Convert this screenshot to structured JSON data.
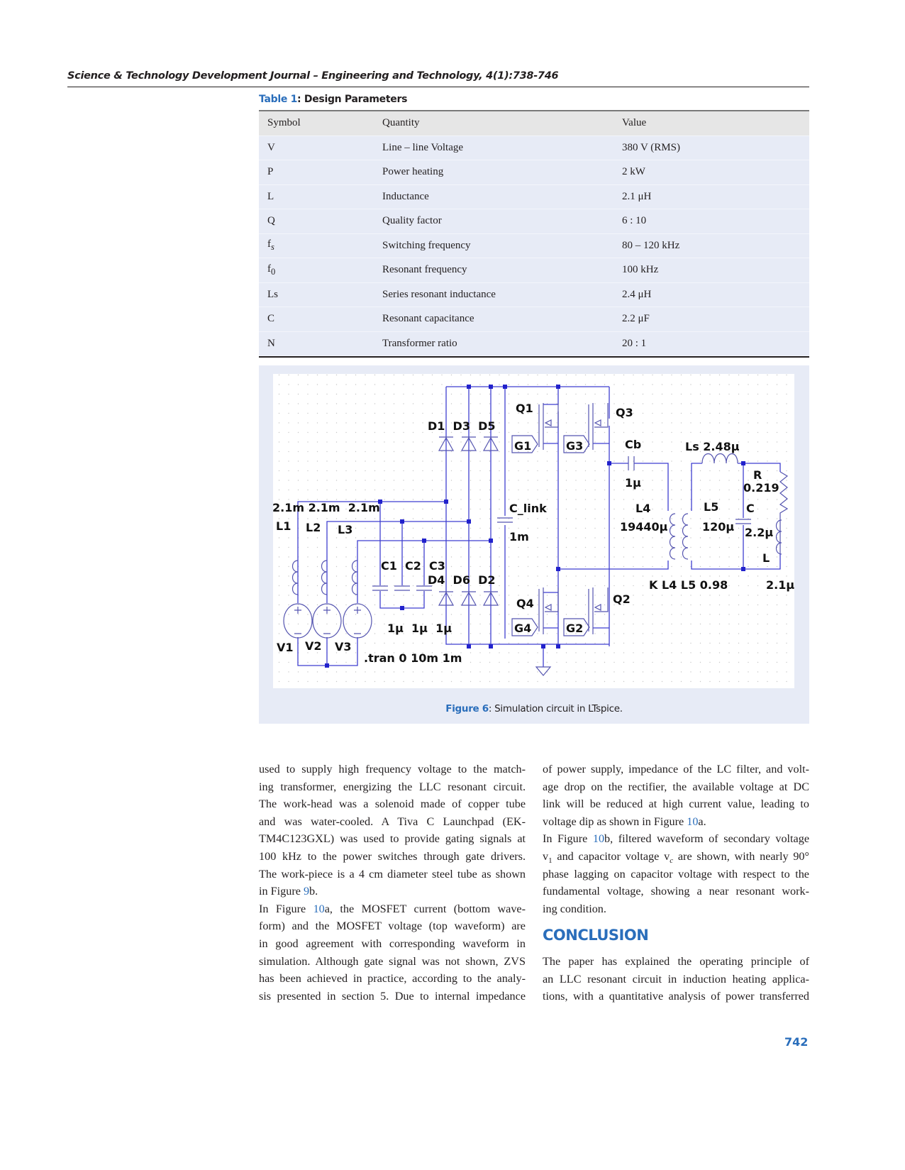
{
  "header": {
    "journal": "Science & Technology Development Journal – Engineering and Technology, 4(1):738-746"
  },
  "table": {
    "caption_label": "Table 1",
    "caption_text": ": Design Parameters",
    "columns": [
      "Symbol",
      "Quantity",
      "Value"
    ],
    "rows": [
      {
        "symbol": "V",
        "sub": "",
        "quantity": "Line – line Voltage",
        "value": "380 V (RMS)"
      },
      {
        "symbol": "P",
        "sub": "",
        "quantity": "Power heating",
        "value": "2 kW"
      },
      {
        "symbol": "L",
        "sub": "",
        "quantity": "Inductance",
        "value": "2.1 μH"
      },
      {
        "symbol": "Q",
        "sub": "",
        "quantity": "Quality factor",
        "value": "6 : 10"
      },
      {
        "symbol": "f",
        "sub": "s",
        "quantity": "Switching frequency",
        "value": "80 – 120 kHz"
      },
      {
        "symbol": "f",
        "sub": "0",
        "quantity": "Resonant frequency",
        "value": "100 kHz"
      },
      {
        "symbol": "Ls",
        "sub": "",
        "quantity": "Series resonant inductance",
        "value": "2.4 μH"
      },
      {
        "symbol": "C",
        "sub": "",
        "quantity": "Resonant capacitance",
        "value": "2.2 μF"
      },
      {
        "symbol": "N",
        "sub": "",
        "quantity": "Transformer ratio",
        "value": "20 : 1"
      }
    ]
  },
  "figure": {
    "caption_label": "Figure 6",
    "caption_text": ": Simulation circuit in LTspice.",
    "wire_color": "#3f3fd0",
    "labels": {
      "q1": "Q1",
      "q2": "Q2",
      "q3": "Q3",
      "q4": "Q4",
      "g1": "G1",
      "g2": "G2",
      "g3": "G3",
      "g4": "G4",
      "d_top": "D1  D3  D5",
      "d_bot": "D4  D6  D2",
      "c_link": "C_link",
      "c_link_val": "1m",
      "cb": "Cb",
      "cb_val": "1μ",
      "ls": "Ls 2.48μ",
      "r": "R",
      "r_val": "0.219",
      "c": "C",
      "c_val": "2.2μ",
      "l": "L",
      "l_val": "2.1μ",
      "l4": "L4",
      "l4_val": "19440μ",
      "l5": "L5",
      "l5_val": "120μ",
      "k": "K L4 L5 0.98",
      "l_vals": "2.1m 2.1m  2.1m",
      "l1": "L1",
      "l2": "L2",
      "l3": "L3",
      "c123": "C1  C2  C3",
      "c123_val": "1μ  1μ  1μ",
      "v1": "V1",
      "v2": "V2",
      "v3": "V3",
      "tran": ".tran 0 10m 1m"
    }
  },
  "body": {
    "left_column": [
      [
        {
          "t": "used to supply high frequency voltage to the match-"
        }
      ],
      [
        {
          "t": "ing transformer, energizing the LLC resonant circuit."
        }
      ],
      [
        {
          "t": "The work-head was a solenoid made of copper tube"
        }
      ],
      [
        {
          "t": "and was water-cooled.   A Tiva C Launchpad (EK-"
        }
      ],
      [
        {
          "t": "TM4C123GXL) was used to provide gating signals at"
        }
      ],
      [
        {
          "t": "100 kHz to the power switches through gate drivers."
        }
      ],
      [
        {
          "t": "The work-piece is a 4 cm diameter steel tube as shown"
        }
      ],
      [
        {
          "t": "in Figure "
        },
        {
          "t": "9",
          "link": true
        },
        {
          "t": "b."
        }
      ],
      [
        {
          "t": "In Figure "
        },
        {
          "t": "10",
          "link": true
        },
        {
          "t": "a, the MOSFET current (bottom wave-"
        }
      ],
      [
        {
          "t": "form) and the MOSFET voltage (top waveform) are"
        }
      ],
      [
        {
          "t": "in good agreement with corresponding waveform in"
        }
      ],
      [
        {
          "t": "simulation. Although gate signal was not shown, ZVS"
        }
      ],
      [
        {
          "t": "has been achieved in practice, according to the analy-"
        }
      ],
      [
        {
          "t": "sis presented in section 5. Due to internal impedance"
        }
      ]
    ],
    "left_last_lines": [
      7
    ],
    "right_column": [
      [
        {
          "t": "of power supply, impedance of the LC filter, and volt-"
        }
      ],
      [
        {
          "t": "age drop on the rectifier, the available voltage at DC"
        }
      ],
      [
        {
          "t": "link will be reduced at high current value, leading to"
        }
      ],
      [
        {
          "t": "voltage dip as shown in Figure "
        },
        {
          "t": "10",
          "link": true
        },
        {
          "t": "a."
        }
      ],
      [
        {
          "t": "In Figure "
        },
        {
          "t": "10",
          "link": true
        },
        {
          "t": "b, filtered waveform of secondary voltage"
        }
      ],
      [
        {
          "t": "v"
        },
        {
          "t": "1",
          "sub": true
        },
        {
          "t": " and capacitor voltage v"
        },
        {
          "t": "c",
          "sub": true,
          "italic": true
        },
        {
          "t": " are shown, with nearly 90°"
        }
      ],
      [
        {
          "t": "phase lagging on capacitor voltage with respect to the"
        }
      ],
      [
        {
          "t": "fundamental voltage, showing a near resonant work-"
        }
      ],
      [
        {
          "t": "ing condition."
        }
      ]
    ],
    "right_last_lines": [
      3,
      8
    ],
    "conclusion_heading": "CONCLUSION",
    "conclusion": [
      [
        {
          "t": "The paper has explained the operating principle of"
        }
      ],
      [
        {
          "t": "an LLC resonant circuit in induction heating applica-"
        }
      ],
      [
        {
          "t": "tions, with a quantitative analysis of power transferred"
        }
      ]
    ]
  },
  "page_number": "742"
}
